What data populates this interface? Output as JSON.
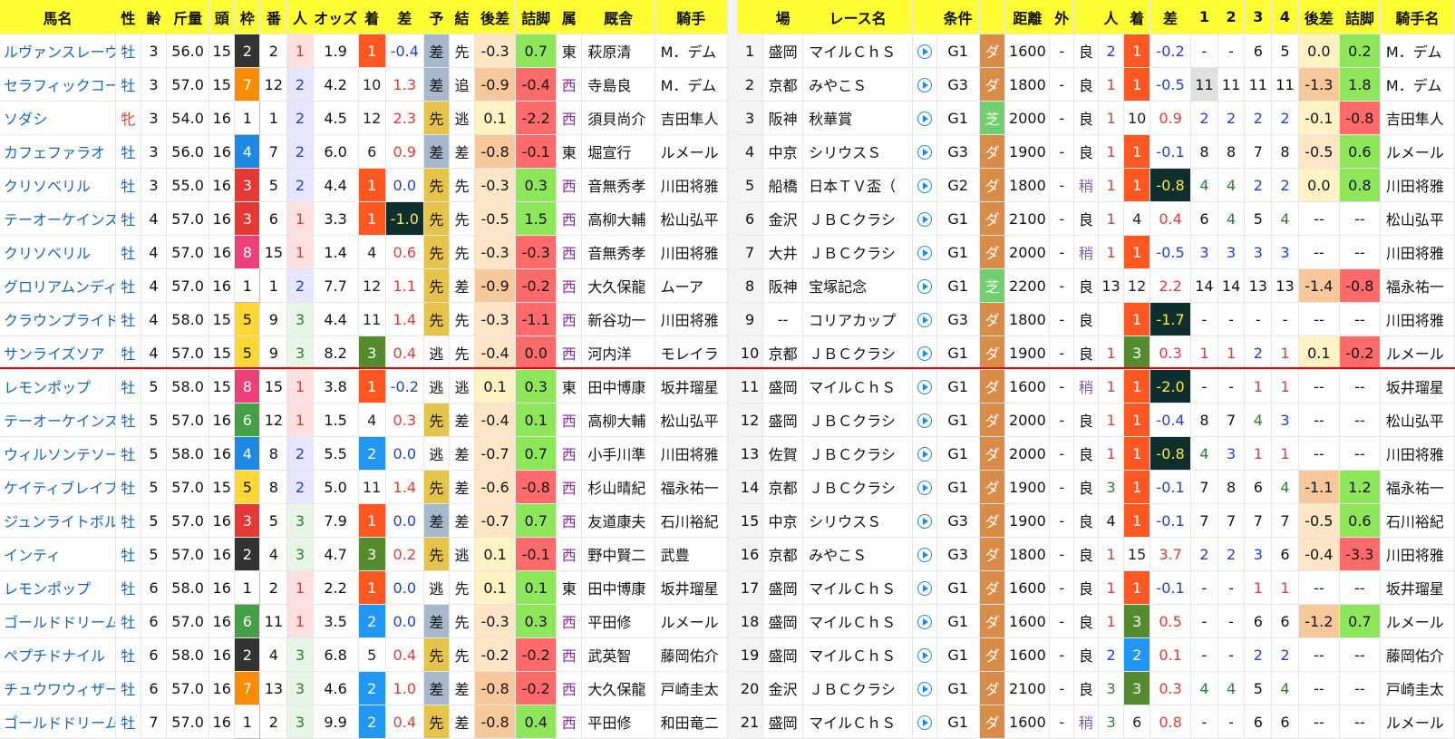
{
  "left_headers": [
    "馬名",
    "性",
    "齢",
    "斤量",
    "頭",
    "枠",
    "番",
    "人",
    "オッズ",
    "着",
    "差",
    "予",
    "結",
    "後差",
    "詰脚",
    "属",
    "厩舎",
    "騎手"
  ],
  "right_headers": [
    "",
    "場",
    "レース名",
    "",
    "条件",
    "",
    "距離",
    "外",
    "",
    "人",
    "着",
    "差",
    "1",
    "2",
    "3",
    "4",
    "後差",
    "詰脚",
    "騎手名"
  ],
  "left_rows": [
    {
      "name": "ルヴァンスレーヴ",
      "sex": "牡",
      "age": "3",
      "kin": "56.0",
      "to": "15",
      "waku": "2",
      "ban": "2",
      "pop": "1",
      "odds": "1.9",
      "chaku": "1",
      "sa": "-0.4",
      "yo": "差",
      "ke": "先",
      "ato": "-0.3",
      "tsume": "0.7",
      "zoku": "東",
      "stable": "萩原清",
      "jockey": "M．デム"
    },
    {
      "name": "セラフィックコール",
      "sex": "牡",
      "age": "3",
      "kin": "57.0",
      "to": "15",
      "waku": "7",
      "ban": "12",
      "pop": "2",
      "odds": "4.2",
      "chaku": "10",
      "sa": "1.3",
      "yo": "差",
      "ke": "追",
      "ato": "-0.9",
      "tsume": "-0.4",
      "zoku": "西",
      "stable": "寺島良",
      "jockey": "M．デム"
    },
    {
      "name": "ソダシ",
      "sex": "牝",
      "age": "3",
      "kin": "54.0",
      "to": "16",
      "waku": "1",
      "ban": "1",
      "pop": "2",
      "odds": "4.5",
      "chaku": "12",
      "sa": "2.3",
      "yo": "先",
      "ke": "逃",
      "ato": "0.1",
      "tsume": "-2.2",
      "zoku": "西",
      "stable": "須貝尚介",
      "jockey": "吉田隼人"
    },
    {
      "name": "カフェファラオ",
      "sex": "牡",
      "age": "3",
      "kin": "56.0",
      "to": "16",
      "waku": "4",
      "ban": "7",
      "pop": "2",
      "odds": "6.0",
      "chaku": "6",
      "sa": "0.9",
      "yo": "差",
      "ke": "差",
      "ato": "-0.8",
      "tsume": "-0.1",
      "zoku": "東",
      "stable": "堀宣行",
      "jockey": "ルメール"
    },
    {
      "name": "クリソベリル",
      "sex": "牡",
      "age": "3",
      "kin": "55.0",
      "to": "16",
      "waku": "3",
      "ban": "5",
      "pop": "2",
      "odds": "4.4",
      "chaku": "1",
      "sa": "0.0",
      "yo": "先",
      "ke": "先",
      "ato": "-0.3",
      "tsume": "0.3",
      "zoku": "西",
      "stable": "音無秀孝",
      "jockey": "川田将雅"
    },
    {
      "name": "テーオーケインズ",
      "sex": "牡",
      "age": "4",
      "kin": "57.0",
      "to": "16",
      "waku": "3",
      "ban": "6",
      "pop": "1",
      "odds": "3.3",
      "chaku": "1",
      "sa": "-1.0",
      "yo": "先",
      "ke": "先",
      "ato": "-0.5",
      "tsume": "1.5",
      "zoku": "西",
      "stable": "高柳大輔",
      "jockey": "松山弘平"
    },
    {
      "name": "クリソベリル",
      "sex": "牡",
      "age": "4",
      "kin": "57.0",
      "to": "16",
      "waku": "8",
      "ban": "15",
      "pop": "1",
      "odds": "1.4",
      "chaku": "4",
      "sa": "0.6",
      "yo": "先",
      "ke": "先",
      "ato": "-0.3",
      "tsume": "-0.3",
      "zoku": "西",
      "stable": "音無秀孝",
      "jockey": "川田将雅"
    },
    {
      "name": "グロリアムンディ",
      "sex": "牡",
      "age": "4",
      "kin": "57.0",
      "to": "16",
      "waku": "1",
      "ban": "1",
      "pop": "2",
      "odds": "7.7",
      "chaku": "12",
      "sa": "1.1",
      "yo": "先",
      "ke": "差",
      "ato": "-0.9",
      "tsume": "-0.2",
      "zoku": "西",
      "stable": "大久保龍",
      "jockey": "ムーア"
    },
    {
      "name": "クラウンプライド",
      "sex": "牡",
      "age": "4",
      "kin": "58.0",
      "to": "15",
      "waku": "5",
      "ban": "9",
      "pop": "3",
      "odds": "4.4",
      "chaku": "11",
      "sa": "1.4",
      "yo": "先",
      "ke": "先",
      "ato": "-0.3",
      "tsume": "-1.1",
      "zoku": "西",
      "stable": "新谷功一",
      "jockey": "川田将雅"
    },
    {
      "name": "サンライズソア",
      "sex": "牡",
      "age": "4",
      "kin": "57.0",
      "to": "15",
      "waku": "5",
      "ban": "9",
      "pop": "3",
      "odds": "8.2",
      "chaku": "3",
      "sa": "0.4",
      "yo": "逃",
      "ke": "先",
      "ato": "-0.4",
      "tsume": "0.0",
      "zoku": "西",
      "stable": "河内洋",
      "jockey": "モレイラ"
    },
    {
      "name": "レモンポップ",
      "sex": "牡",
      "age": "5",
      "kin": "58.0",
      "to": "15",
      "waku": "8",
      "ban": "15",
      "pop": "1",
      "odds": "3.8",
      "chaku": "1",
      "sa": "-0.2",
      "yo": "逃",
      "ke": "逃",
      "ato": "0.1",
      "tsume": "0.3",
      "zoku": "東",
      "stable": "田中博康",
      "jockey": "坂井瑠星"
    },
    {
      "name": "テーオーケインズ",
      "sex": "牡",
      "age": "5",
      "kin": "57.0",
      "to": "16",
      "waku": "6",
      "ban": "12",
      "pop": "1",
      "odds": "1.5",
      "chaku": "4",
      "sa": "0.3",
      "yo": "先",
      "ke": "差",
      "ato": "-0.4",
      "tsume": "0.1",
      "zoku": "西",
      "stable": "高柳大輔",
      "jockey": "松山弘平"
    },
    {
      "name": "ウィルソンテソーロ",
      "sex": "牡",
      "age": "5",
      "kin": "58.0",
      "to": "16",
      "waku": "4",
      "ban": "8",
      "pop": "2",
      "odds": "5.5",
      "chaku": "2",
      "sa": "0.0",
      "yo": "逃",
      "ke": "差",
      "ato": "-0.7",
      "tsume": "0.7",
      "zoku": "西",
      "stable": "小手川準",
      "jockey": "川田将雅"
    },
    {
      "name": "ケイティブレイブ",
      "sex": "牡",
      "age": "5",
      "kin": "57.0",
      "to": "15",
      "waku": "5",
      "ban": "8",
      "pop": "2",
      "odds": "5.0",
      "chaku": "11",
      "sa": "1.4",
      "yo": "先",
      "ke": "差",
      "ato": "-0.6",
      "tsume": "-0.8",
      "zoku": "西",
      "stable": "杉山晴紀",
      "jockey": "福永祐一"
    },
    {
      "name": "ジュンライトボルト",
      "sex": "牡",
      "age": "5",
      "kin": "57.0",
      "to": "16",
      "waku": "3",
      "ban": "5",
      "pop": "3",
      "odds": "7.9",
      "chaku": "1",
      "sa": "0.0",
      "yo": "差",
      "ke": "差",
      "ato": "-0.7",
      "tsume": "0.7",
      "zoku": "西",
      "stable": "友道康夫",
      "jockey": "石川裕紀"
    },
    {
      "name": "インティ",
      "sex": "牡",
      "age": "5",
      "kin": "57.0",
      "to": "16",
      "waku": "2",
      "ban": "4",
      "pop": "3",
      "odds": "4.7",
      "chaku": "3",
      "sa": "0.2",
      "yo": "先",
      "ke": "逃",
      "ato": "0.1",
      "tsume": "-0.1",
      "zoku": "西",
      "stable": "野中賢二",
      "jockey": "武豊"
    },
    {
      "name": "レモンポップ",
      "sex": "牡",
      "age": "6",
      "kin": "58.0",
      "to": "16",
      "waku": "1",
      "ban": "2",
      "pop": "1",
      "odds": "2.2",
      "chaku": "1",
      "sa": "0.0",
      "yo": "逃",
      "ke": "先",
      "ato": "0.1",
      "tsume": "0.1",
      "zoku": "東",
      "stable": "田中博康",
      "jockey": "坂井瑠星"
    },
    {
      "name": "ゴールドドリーム",
      "sex": "牡",
      "age": "6",
      "kin": "57.0",
      "to": "16",
      "waku": "6",
      "ban": "11",
      "pop": "1",
      "odds": "3.5",
      "chaku": "2",
      "sa": "0.0",
      "yo": "差",
      "ke": "先",
      "ato": "-0.3",
      "tsume": "0.3",
      "zoku": "西",
      "stable": "平田修",
      "jockey": "ルメール"
    },
    {
      "name": "ペプチドナイル",
      "sex": "牡",
      "age": "6",
      "kin": "58.0",
      "to": "16",
      "waku": "2",
      "ban": "4",
      "pop": "3",
      "odds": "6.8",
      "chaku": "5",
      "sa": "0.4",
      "yo": "先",
      "ke": "先",
      "ato": "-0.2",
      "tsume": "-0.2",
      "zoku": "西",
      "stable": "武英智",
      "jockey": "藤岡佑介"
    },
    {
      "name": "チュウワウィザード",
      "sex": "牡",
      "age": "6",
      "kin": "57.0",
      "to": "16",
      "waku": "7",
      "ban": "13",
      "pop": "3",
      "odds": "4.6",
      "chaku": "2",
      "sa": "1.0",
      "yo": "差",
      "ke": "差",
      "ato": "-0.8",
      "tsume": "-0.2",
      "zoku": "西",
      "stable": "大久保龍",
      "jockey": "戸崎圭太"
    },
    {
      "name": "ゴールドドリーム",
      "sex": "牡",
      "age": "7",
      "kin": "57.0",
      "to": "16",
      "waku": "1",
      "ban": "2",
      "pop": "3",
      "odds": "9.9",
      "chaku": "2",
      "sa": "0.4",
      "yo": "先",
      "ke": "差",
      "ato": "-0.8",
      "tsume": "0.4",
      "zoku": "西",
      "stable": "平田修",
      "jockey": "和田竜二"
    }
  ],
  "right_rows": [
    {
      "no": "1",
      "place": "盛岡",
      "race": "マイルＣｈＳ",
      "grade": "G1",
      "surf": "ダ",
      "dist": "1600",
      "gai": "-",
      "cond": "良",
      "pop": "2",
      "chaku": "1",
      "sa": "-0.2",
      "p1": "-",
      "p2": "-",
      "p3": "6",
      "p4": "5",
      "ato": "0.0",
      "tsume": "0.2",
      "jockey": "M．デム"
    },
    {
      "no": "2",
      "place": "京都",
      "race": "みやこＳ",
      "grade": "G3",
      "surf": "ダ",
      "dist": "1800",
      "gai": "-",
      "cond": "良",
      "pop": "1",
      "chaku": "1",
      "sa": "-0.5",
      "p1": "11",
      "p2": "11",
      "p3": "11",
      "p4": "11",
      "ato": "-1.3",
      "tsume": "1.8",
      "jockey": "M．デム"
    },
    {
      "no": "3",
      "place": "阪神",
      "race": "秋華賞",
      "grade": "G1",
      "surf": "芝",
      "dist": "2000",
      "gai": "-",
      "cond": "良",
      "pop": "1",
      "chaku": "10",
      "sa": "0.9",
      "p1": "2",
      "p2": "2",
      "p3": "2",
      "p4": "2",
      "ato": "-0.1",
      "tsume": "-0.8",
      "jockey": "吉田隼人"
    },
    {
      "no": "4",
      "place": "中京",
      "race": "シリウスＳ",
      "grade": "G3",
      "surf": "ダ",
      "dist": "1900",
      "gai": "-",
      "cond": "良",
      "pop": "1",
      "chaku": "1",
      "sa": "-0.1",
      "p1": "8",
      "p2": "8",
      "p3": "7",
      "p4": "8",
      "ato": "-0.5",
      "tsume": "0.6",
      "jockey": "ルメール"
    },
    {
      "no": "5",
      "place": "船橋",
      "race": "日本ＴＶ盃（",
      "grade": "G2",
      "surf": "ダ",
      "dist": "1800",
      "gai": "-",
      "cond": "稍",
      "pop": "1",
      "chaku": "1",
      "sa": "-0.8",
      "p1": "4",
      "p2": "4",
      "p3": "2",
      "p4": "2",
      "ato": "0.0",
      "tsume": "0.8",
      "jockey": "川田将雅"
    },
    {
      "no": "6",
      "place": "金沢",
      "race": "ＪＢＣクラシ",
      "grade": "G1",
      "surf": "ダ",
      "dist": "2100",
      "gai": "-",
      "cond": "良",
      "pop": "1",
      "chaku": "4",
      "sa": "0.4",
      "p1": "6",
      "p2": "4",
      "p3": "5",
      "p4": "4",
      "ato": "--",
      "tsume": "--",
      "jockey": "松山弘平"
    },
    {
      "no": "7",
      "place": "大井",
      "race": "ＪＢＣクラシ",
      "grade": "G1",
      "surf": "ダ",
      "dist": "2000",
      "gai": "-",
      "cond": "稍",
      "pop": "1",
      "chaku": "1",
      "sa": "-0.5",
      "p1": "3",
      "p2": "3",
      "p3": "3",
      "p4": "3",
      "ato": "--",
      "tsume": "--",
      "jockey": "川田将雅"
    },
    {
      "no": "8",
      "place": "阪神",
      "race": "宝塚記念",
      "grade": "G1",
      "surf": "芝",
      "dist": "2200",
      "gai": "-",
      "cond": "良",
      "pop": "13",
      "chaku": "12",
      "sa": "2.2",
      "p1": "14",
      "p2": "14",
      "p3": "13",
      "p4": "13",
      "ato": "-1.4",
      "tsume": "-0.8",
      "jockey": "福永祐一"
    },
    {
      "no": "9",
      "place": "--",
      "race": "コリアカップ",
      "grade": "G3",
      "surf": "ダ",
      "dist": "1800",
      "gai": "-",
      "cond": "良",
      "pop": "",
      "chaku": "1",
      "sa": "-1.7",
      "p1": "-",
      "p2": "-",
      "p3": "-",
      "p4": "-",
      "ato": "--",
      "tsume": "--",
      "jockey": "川田将雅"
    },
    {
      "no": "10",
      "place": "京都",
      "race": "ＪＢＣクラシ",
      "grade": "G1",
      "surf": "ダ",
      "dist": "1900",
      "gai": "-",
      "cond": "良",
      "pop": "1",
      "chaku": "3",
      "sa": "0.3",
      "p1": "1",
      "p2": "1",
      "p3": "2",
      "p4": "1",
      "ato": "0.1",
      "tsume": "-0.2",
      "jockey": "ルメール"
    },
    {
      "no": "11",
      "place": "盛岡",
      "race": "マイルＣｈＳ",
      "grade": "G1",
      "surf": "ダ",
      "dist": "1600",
      "gai": "-",
      "cond": "稍",
      "pop": "1",
      "chaku": "1",
      "sa": "-2.0",
      "p1": "-",
      "p2": "-",
      "p3": "1",
      "p4": "1",
      "ato": "--",
      "tsume": "--",
      "jockey": "坂井瑠星"
    },
    {
      "no": "12",
      "place": "盛岡",
      "race": "ＪＢＣクラシ",
      "grade": "G1",
      "surf": "ダ",
      "dist": "2000",
      "gai": "-",
      "cond": "良",
      "pop": "1",
      "chaku": "1",
      "sa": "-0.4",
      "p1": "8",
      "p2": "7",
      "p3": "4",
      "p4": "3",
      "ato": "--",
      "tsume": "--",
      "jockey": "松山弘平"
    },
    {
      "no": "13",
      "place": "佐賀",
      "race": "ＪＢＣクラシ",
      "grade": "G1",
      "surf": "ダ",
      "dist": "2000",
      "gai": "-",
      "cond": "良",
      "pop": "1",
      "chaku": "1",
      "sa": "-0.8",
      "p1": "4",
      "p2": "3",
      "p3": "1",
      "p4": "1",
      "ato": "--",
      "tsume": "--",
      "jockey": "川田将雅"
    },
    {
      "no": "14",
      "place": "京都",
      "race": "ＪＢＣクラシ",
      "grade": "G1",
      "surf": "ダ",
      "dist": "1900",
      "gai": "-",
      "cond": "良",
      "pop": "3",
      "chaku": "1",
      "sa": "-0.1",
      "p1": "7",
      "p2": "8",
      "p3": "6",
      "p4": "4",
      "ato": "-1.1",
      "tsume": "1.2",
      "jockey": "福永祐一"
    },
    {
      "no": "15",
      "place": "中京",
      "race": "シリウスＳ",
      "grade": "G3",
      "surf": "ダ",
      "dist": "1900",
      "gai": "-",
      "cond": "良",
      "pop": "4",
      "chaku": "1",
      "sa": "-0.1",
      "p1": "7",
      "p2": "7",
      "p3": "7",
      "p4": "7",
      "ato": "-0.5",
      "tsume": "0.6",
      "jockey": "石川裕紀"
    },
    {
      "no": "16",
      "place": "京都",
      "race": "みやこＳ",
      "grade": "G3",
      "surf": "ダ",
      "dist": "1800",
      "gai": "-",
      "cond": "良",
      "pop": "1",
      "chaku": "15",
      "sa": "3.7",
      "p1": "2",
      "p2": "2",
      "p3": "3",
      "p4": "6",
      "ato": "-0.4",
      "tsume": "-3.3",
      "jockey": "川田将雅"
    },
    {
      "no": "17",
      "place": "盛岡",
      "race": "マイルＣｈＳ",
      "grade": "G1",
      "surf": "ダ",
      "dist": "1600",
      "gai": "-",
      "cond": "良",
      "pop": "1",
      "chaku": "1",
      "sa": "-0.1",
      "p1": "-",
      "p2": "-",
      "p3": "1",
      "p4": "1",
      "ato": "--",
      "tsume": "--",
      "jockey": "坂井瑠星"
    },
    {
      "no": "18",
      "place": "盛岡",
      "race": "マイルＣｈＳ",
      "grade": "G1",
      "surf": "ダ",
      "dist": "1600",
      "gai": "-",
      "cond": "良",
      "pop": "1",
      "chaku": "3",
      "sa": "0.5",
      "p1": "-",
      "p2": "-",
      "p3": "6",
      "p4": "6",
      "ato": "-1.2",
      "tsume": "0.7",
      "jockey": "ルメール"
    },
    {
      "no": "19",
      "place": "盛岡",
      "race": "マイルＣｈＳ",
      "grade": "G1",
      "surf": "ダ",
      "dist": "1600",
      "gai": "-",
      "cond": "良",
      "pop": "2",
      "chaku": "2",
      "sa": "0.1",
      "p1": "-",
      "p2": "-",
      "p3": "2",
      "p4": "2",
      "ato": "--",
      "tsume": "--",
      "jockey": "藤岡佑介"
    },
    {
      "no": "20",
      "place": "金沢",
      "race": "ＪＢＣクラシ",
      "grade": "G1",
      "surf": "ダ",
      "dist": "2100",
      "gai": "-",
      "cond": "良",
      "pop": "3",
      "chaku": "3",
      "sa": "0.3",
      "p1": "4",
      "p2": "4",
      "p3": "5",
      "p4": "4",
      "ato": "--",
      "tsume": "--",
      "jockey": "戸崎圭太"
    },
    {
      "no": "21",
      "place": "盛岡",
      "race": "マイルＣｈＳ",
      "grade": "G1",
      "surf": "ダ",
      "dist": "1600",
      "gai": "-",
      "cond": "稍",
      "pop": "3",
      "chaku": "6",
      "sa": "0.8",
      "p1": "-",
      "p2": "-",
      "p3": "6",
      "p4": "6",
      "ato": "--",
      "tsume": "--",
      "jockey": "ルメール"
    }
  ],
  "colors": {
    "header_bg": "#ffff33",
    "link_blue": "#1565c0",
    "separator_red": "#ee0000"
  },
  "icons": {
    "video": "play-circle-icon"
  }
}
